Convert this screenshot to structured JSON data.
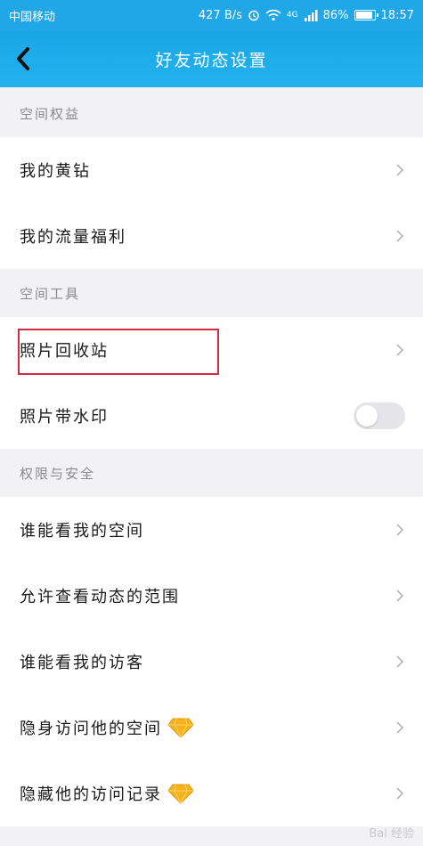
{
  "status_bar": {
    "carrier": "中国移动",
    "speed": "427 B/s",
    "network": "4G",
    "battery": "86%",
    "time": "18:57"
  },
  "nav": {
    "title": "好友动态设置"
  },
  "sections": [
    {
      "header": "空间权益",
      "items": [
        "我的黄钻",
        "我的流量福利"
      ]
    },
    {
      "header": "空间工具",
      "items": [
        "照片回收站",
        "照片带水印"
      ]
    },
    {
      "header": "权限与安全",
      "items": [
        "谁能看我的空间",
        "允许查看动态的范围",
        "谁能看我的访客",
        "隐身访问他的空间",
        "隐藏他的访问记录"
      ]
    }
  ],
  "toggles": {
    "watermark_on": false
  },
  "icons": {
    "back": "back-arrow-icon",
    "chevron": "chevron-right-icon",
    "diamond": "yellow-diamond-icon"
  },
  "colors": {
    "nav_bar": "#1fa7e8",
    "highlight_box": "#d42b45",
    "diamond": "#f6b21a"
  },
  "watermark": "Bai 经验"
}
